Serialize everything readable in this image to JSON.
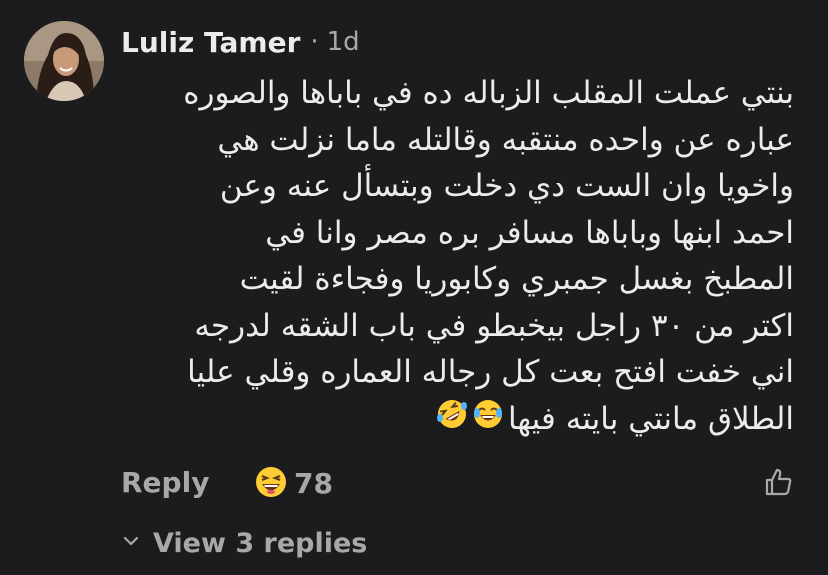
{
  "comment": {
    "author": "Luliz Tamer",
    "separator": "·",
    "timestamp": "1d",
    "lines": [
      "بنتي عملت المقلب الزباله ده في باباها والصوره",
      "عباره عن واحده منتقبه وقالتله ماما نزلت هي",
      "واخويا وان الست دي دخلت وبتسأل عنه وعن",
      "احمد ابنها وباباها مسافر بره مصر وانا في",
      "المطبخ بغسل جمبري وكابوريا وفجاءة لقيت",
      "اكتر من ٣٠ راجل بيخبطو في باب الشقه لدرجه",
      "اني خفت افتح بعت كل رجاله العماره وقلي عليا",
      "الطلاق مانتي بايته فيها"
    ],
    "emojis": [
      "face-with-tears-of-joy",
      "rolling-on-the-floor-laughing"
    ]
  },
  "actions": {
    "reply_label": "Reply",
    "reaction_emoji": "grinning-squinting-face",
    "reaction_count": "78",
    "like_icon": "thumbs-up-outline-icon"
  },
  "replies": {
    "label": "View 3 replies",
    "icon": "chevron-down-icon"
  },
  "colors": {
    "background": "#1c1c1e",
    "primary_text": "#ececec",
    "secondary_text": "#a8a8ab",
    "emoji_yellow": "#ffcc33",
    "tear_blue": "#4fb3ff"
  }
}
